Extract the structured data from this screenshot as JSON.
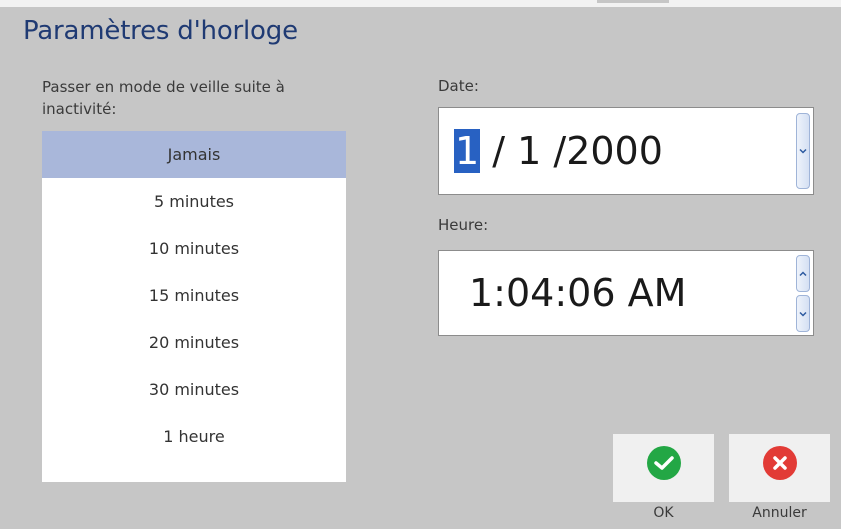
{
  "window": {
    "title": "Paramètres d'horloge"
  },
  "sleep": {
    "label": "Passer en mode de veille suite à inactivité:",
    "selected": "Jamais",
    "options": [
      "Jamais",
      "5 minutes",
      "10 minutes",
      "15 minutes",
      "20 minutes",
      "30 minutes",
      "1 heure"
    ]
  },
  "date": {
    "label": "Date:",
    "day": "1",
    "rest": " / 1 /2000"
  },
  "time": {
    "label": "Heure:",
    "value": "1:04:06 AM"
  },
  "buttons": {
    "ok_label": "OK",
    "cancel_label": "Annuler"
  },
  "colors": {
    "title": "#1f3a73",
    "selection": "#a9b7da",
    "ok": "#23a745",
    "cancel": "#e23b36"
  },
  "icons": {
    "ok": "checkmark-icon",
    "cancel": "close-icon",
    "spin_up": "chevron-up-icon",
    "spin_down": "chevron-down-icon"
  }
}
